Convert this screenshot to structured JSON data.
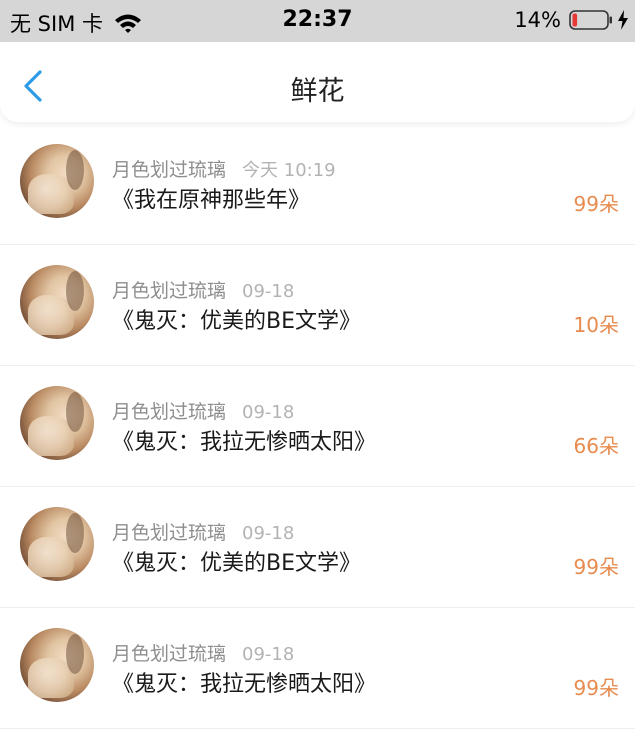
{
  "status_bar": {
    "carrier": "无 SIM 卡",
    "time": "22:37",
    "battery_percent": "14%",
    "battery_level": 0.14,
    "icons": [
      "wifi-icon",
      "battery-icon",
      "charging-bolt-icon"
    ]
  },
  "nav": {
    "title": "鲜花",
    "back_icon": "chevron-left-icon"
  },
  "colors": {
    "accent_blue": "#2f9be8",
    "count_orange": "#e88b4f",
    "author_gray": "#8e8e8e",
    "time_gray": "#b3b3b3",
    "battery_red": "#e53935"
  },
  "records": [
    {
      "author": "月色划过琉璃",
      "time": "今天 10:19",
      "title": "《我在原神那些年》",
      "count": "99朵"
    },
    {
      "author": "月色划过琉璃",
      "time": "09-18",
      "title": "《鬼灭：优美的BE文学》",
      "count": "10朵"
    },
    {
      "author": "月色划过琉璃",
      "time": "09-18",
      "title": "《鬼灭：我拉无惨晒太阳》",
      "count": "66朵"
    },
    {
      "author": "月色划过琉璃",
      "time": "09-18",
      "title": "《鬼灭：优美的BE文学》",
      "count": "99朵"
    },
    {
      "author": "月色划过琉璃",
      "time": "09-18",
      "title": "《鬼灭：我拉无惨晒太阳》",
      "count": "99朵"
    }
  ]
}
